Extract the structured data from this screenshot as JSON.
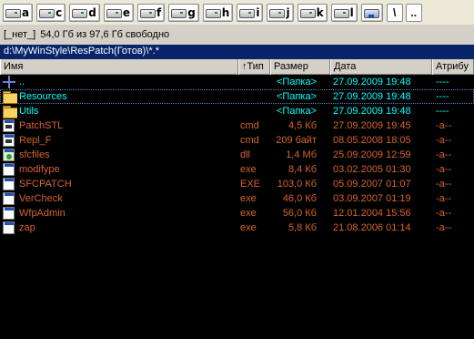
{
  "drives": [
    {
      "letter": "a"
    },
    {
      "letter": "c"
    },
    {
      "letter": "d"
    },
    {
      "letter": "e"
    },
    {
      "letter": "f"
    },
    {
      "letter": "g"
    },
    {
      "letter": "h"
    },
    {
      "letter": "i"
    },
    {
      "letter": "j"
    },
    {
      "letter": "k"
    },
    {
      "letter": "l"
    }
  ],
  "toolbar": {
    "network_icon": "network-icon",
    "root_label": "\\",
    "up_label": ".."
  },
  "freespace": {
    "label": "[_нет_]",
    "text": "54,0 Гб из 97,6 Гб свободно"
  },
  "path": "d:\\MyWinStyle\\ResPatch(Готов)\\*.*",
  "columns": {
    "name": "Имя",
    "ext": "↑Тип",
    "size": "Размер",
    "date": "Дата",
    "attr": "Атрибу"
  },
  "files": [
    {
      "icon": "up-icon",
      "name": "..",
      "ext": "",
      "size": "<Папка>",
      "date": "27.09.2009 19:48",
      "attr": "----",
      "kind": "dir"
    },
    {
      "icon": "folder-icon",
      "name": "Resources",
      "ext": "",
      "size": "<Папка>",
      "date": "27.09.2009 19:48",
      "attr": "----",
      "kind": "dir"
    },
    {
      "icon": "folder-icon",
      "name": "Utils",
      "ext": "",
      "size": "<Папка>",
      "date": "27.09.2009 19:48",
      "attr": "----",
      "kind": "dir"
    },
    {
      "icon": "cmd-icon",
      "name": "PatchSTL",
      "ext": "cmd",
      "size": "4,5 Кб",
      "date": "27.09.2009 19:45",
      "attr": "-a--",
      "kind": "file"
    },
    {
      "icon": "cmd-icon",
      "name": "Repl_F",
      "ext": "cmd",
      "size": "209 байт",
      "date": "08.05.2008 18:05",
      "attr": "-a--",
      "kind": "file"
    },
    {
      "icon": "dll-icon",
      "name": "sfcfiles",
      "ext": "dll",
      "size": "1,4 Мб",
      "date": "25.09.2009 12:59",
      "attr": "-a--",
      "kind": "file"
    },
    {
      "icon": "exe-icon",
      "name": "modifype",
      "ext": "exe",
      "size": "8,4 Кб",
      "date": "03.02.2005 01:30",
      "attr": "-a--",
      "kind": "file"
    },
    {
      "icon": "exe-icon",
      "name": "SFCPATCH",
      "ext": "EXE",
      "size": "103,0 Кб",
      "date": "05.09.2007 01:07",
      "attr": "-a--",
      "kind": "file"
    },
    {
      "icon": "exe-icon",
      "name": "VerCheck",
      "ext": "exe",
      "size": "46,0 Кб",
      "date": "03.09.2007 01:19",
      "attr": "-a--",
      "kind": "file"
    },
    {
      "icon": "exe-icon",
      "name": "WfpAdmin",
      "ext": "exe",
      "size": "56,0 Кб",
      "date": "12.01.2004 15:56",
      "attr": "-a--",
      "kind": "file"
    },
    {
      "icon": "exe-icon",
      "name": "zap",
      "ext": "exe",
      "size": "5,8 Кб",
      "date": "21.08.2006 01:14",
      "attr": "-a--",
      "kind": "file"
    }
  ],
  "colors": {
    "dir": "#00ffff",
    "file": "#d6632d",
    "background": "#000000",
    "pathbar": "#0a246a"
  },
  "cursor_row": 1
}
